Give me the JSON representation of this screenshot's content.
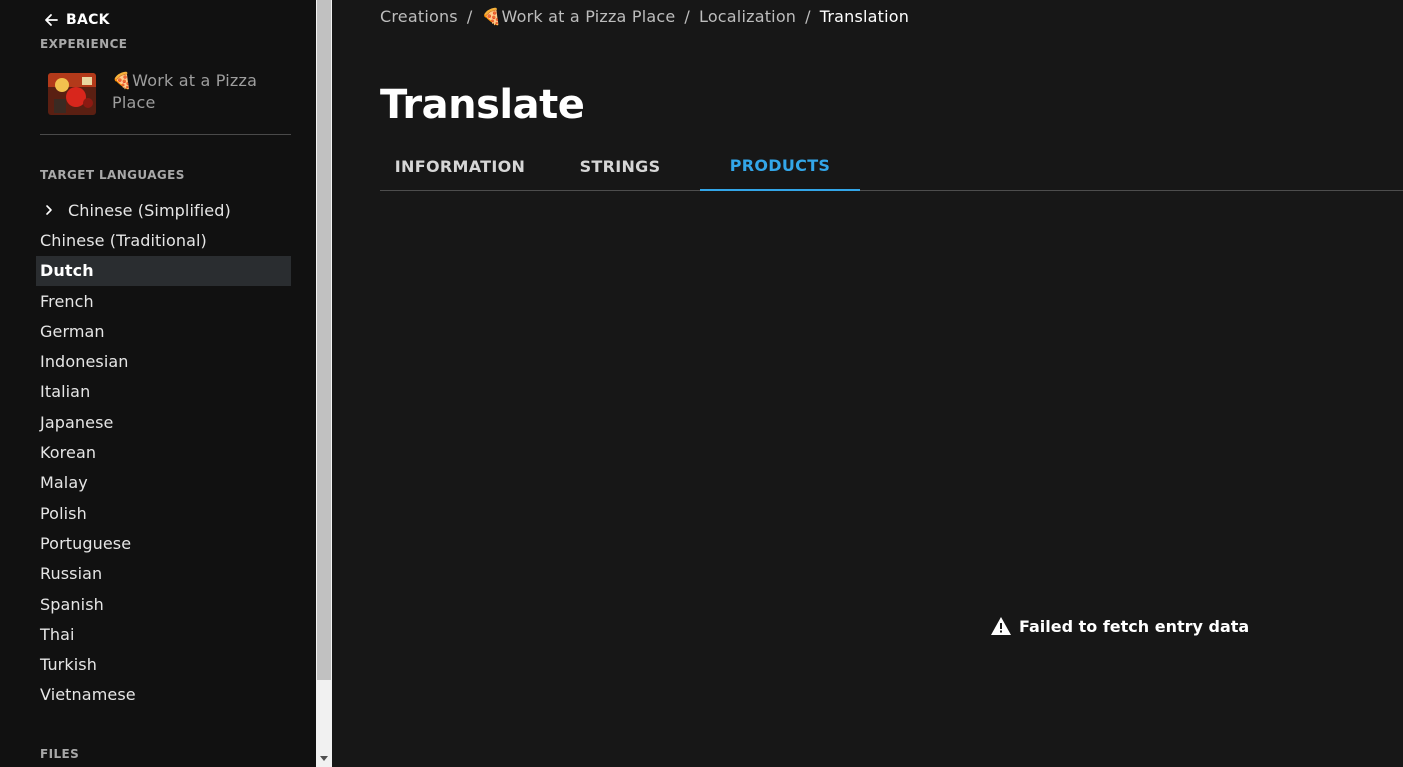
{
  "sidebar": {
    "back_label": "BACK",
    "experience_label": "EXPERIENCE",
    "experience_name": "🍕Work at a Pizza Place",
    "target_languages_label": "TARGET LANGUAGES",
    "languages": [
      {
        "label": "Chinese (Simplified)"
      },
      {
        "label": "Chinese (Traditional)"
      },
      {
        "label": "Dutch"
      },
      {
        "label": "French"
      },
      {
        "label": "German"
      },
      {
        "label": "Indonesian"
      },
      {
        "label": "Italian"
      },
      {
        "label": "Japanese"
      },
      {
        "label": "Korean"
      },
      {
        "label": "Malay"
      },
      {
        "label": "Polish"
      },
      {
        "label": "Portuguese"
      },
      {
        "label": "Russian"
      },
      {
        "label": "Spanish"
      },
      {
        "label": "Thai"
      },
      {
        "label": "Turkish"
      },
      {
        "label": "Vietnamese"
      }
    ],
    "active_language": "Dutch",
    "files_label": "FILES"
  },
  "breadcrumb": {
    "items": [
      "Creations",
      "🍕Work at a Pizza Place",
      "Localization",
      "Translation"
    ],
    "separator": "/"
  },
  "main": {
    "title": "Translate",
    "tabs": [
      {
        "label": "INFORMATION"
      },
      {
        "label": "STRINGS"
      },
      {
        "label": "PRODUCTS"
      }
    ],
    "active_tab": "PRODUCTS",
    "error_message": "Failed to fetch entry data"
  },
  "colors": {
    "accent": "#33a6e8",
    "background": "#171717",
    "sidebar": "#111111",
    "active_item": "#2a2d30"
  }
}
